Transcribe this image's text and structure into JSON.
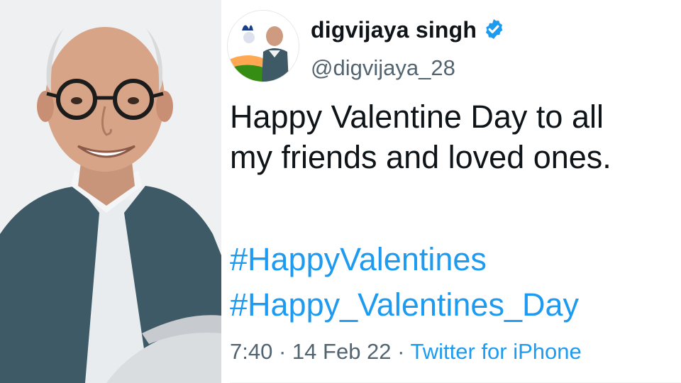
{
  "photo": {
    "icon": "person-portrait-icon"
  },
  "tweet": {
    "author": {
      "display_name": "digvijaya singh",
      "handle": "@digvijaya_28",
      "verified": true,
      "avatar_icon": "avatar-portrait-icon"
    },
    "text_line1": "Happy Valentine Day to all",
    "text_line2": "my friends and loved ones.",
    "hashtags": [
      "#HappyValentines",
      "#Happy_Valentines_Day"
    ],
    "time": "7:40",
    "separator": "·",
    "date": "14 Feb 22",
    "source": "Twitter for iPhone"
  },
  "colors": {
    "text": "#0f1419",
    "muted": "#536471",
    "link": "#1d9bf0",
    "verified": "#1d9bf0"
  }
}
